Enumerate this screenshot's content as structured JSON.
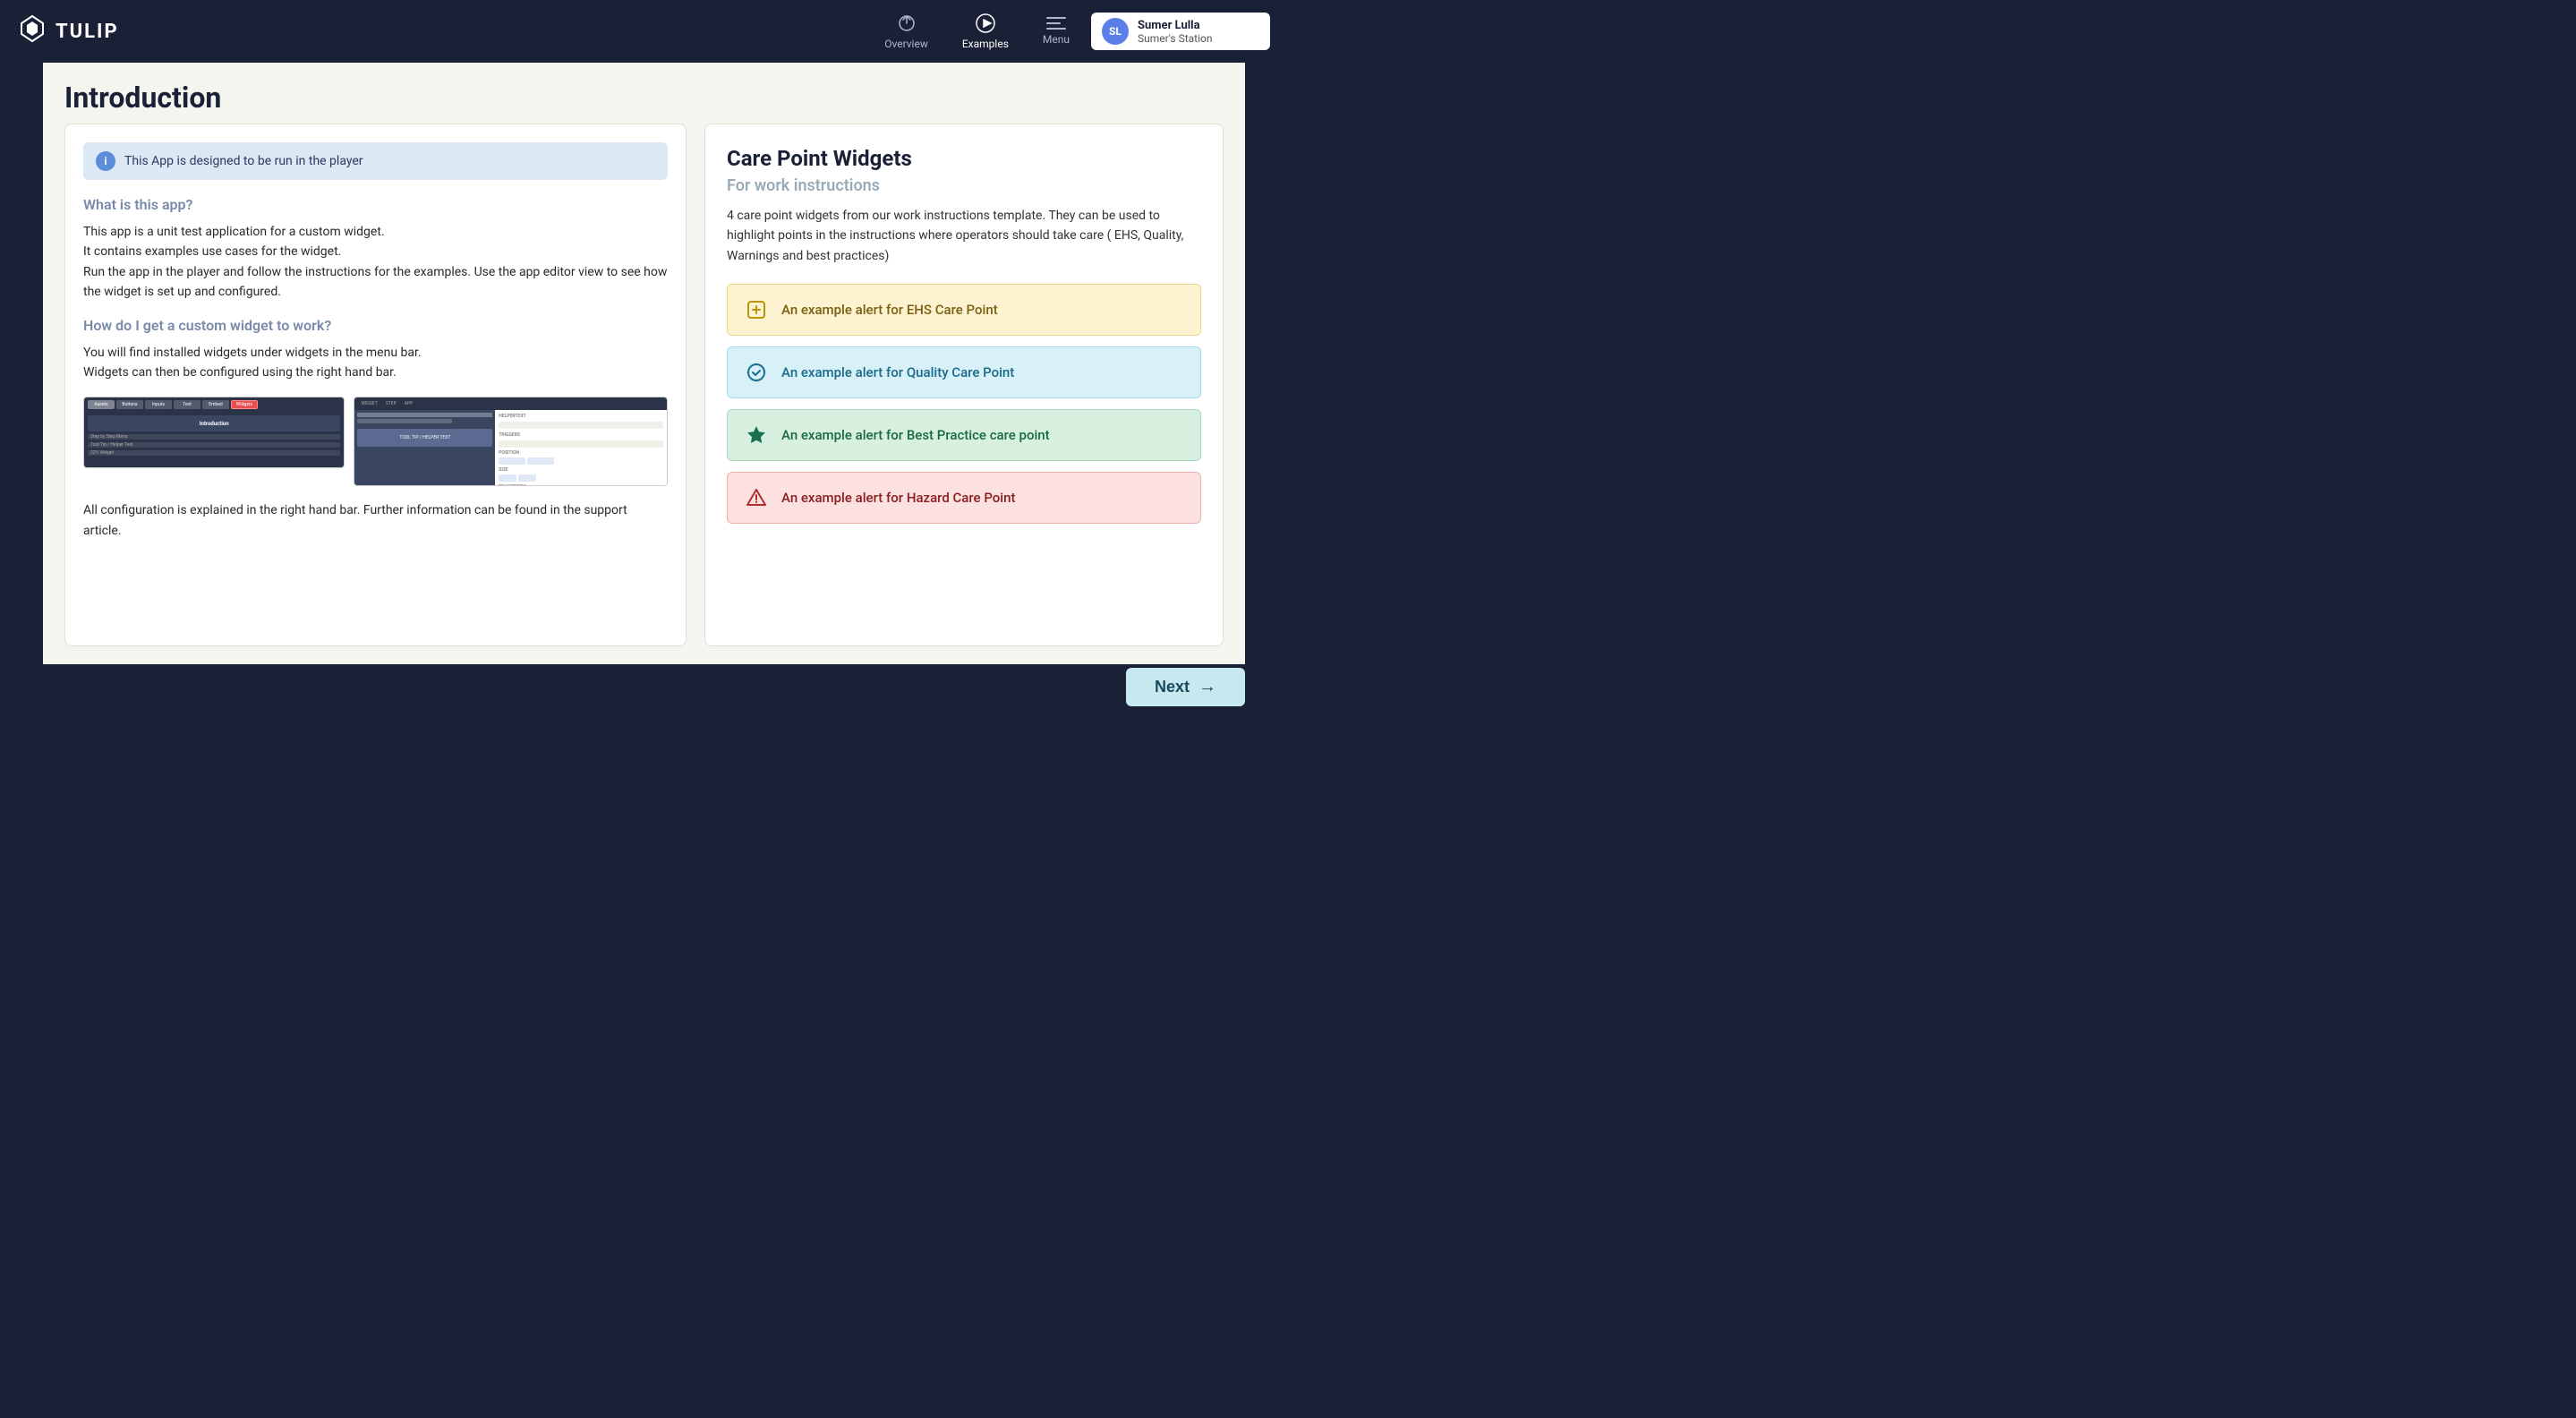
{
  "header": {
    "logo_text": "TULIP",
    "nav": [
      {
        "id": "overview",
        "label": "Overview"
      },
      {
        "id": "examples",
        "label": "Examples",
        "active": true
      },
      {
        "id": "menu",
        "label": "Menu"
      }
    ],
    "user": {
      "initials": "SL",
      "name": "Sumer Lulla",
      "station": "Sumer's Station"
    }
  },
  "page": {
    "title": "Introduction",
    "left_panel": {
      "info_banner": "This App is designed to be run in the player",
      "sections": [
        {
          "heading": "What is this app?",
          "body": "This app is a unit test application for a custom widget.\nIt contains examples use cases for the widget.\nRun the app in the player and follow the instructions for the examples. Use the app editor view to see how the widget is set up and configured."
        },
        {
          "heading": "How do I get a custom widget to work?",
          "body": "You will find installed widgets under widgets in the menu bar.\nWidgets can then be configured using the right hand bar."
        },
        {
          "body2": "All configuration is explained in the right hand bar. Further information can be found in the support article."
        }
      ]
    },
    "right_panel": {
      "title": "Care Point Widgets",
      "subtitle": "For work instructions",
      "description": "4 care point widgets from our work instructions template. They can be used to highlight points in the instructions where operators should take care ( EHS, Quality, Warnings and best practices)",
      "alerts": [
        {
          "type": "ehs",
          "icon": "plus-square",
          "text": "An example alert for EHS Care Point"
        },
        {
          "type": "quality",
          "icon": "check-badge",
          "text": "An example alert for Quality Care Point"
        },
        {
          "type": "bestpractice",
          "icon": "star",
          "text": "An example alert for Best Practice care point"
        },
        {
          "type": "hazard",
          "icon": "warning-triangle",
          "text": "An example alert for Hazard Care Point"
        }
      ]
    }
  },
  "footer": {
    "next_label": "Next"
  }
}
